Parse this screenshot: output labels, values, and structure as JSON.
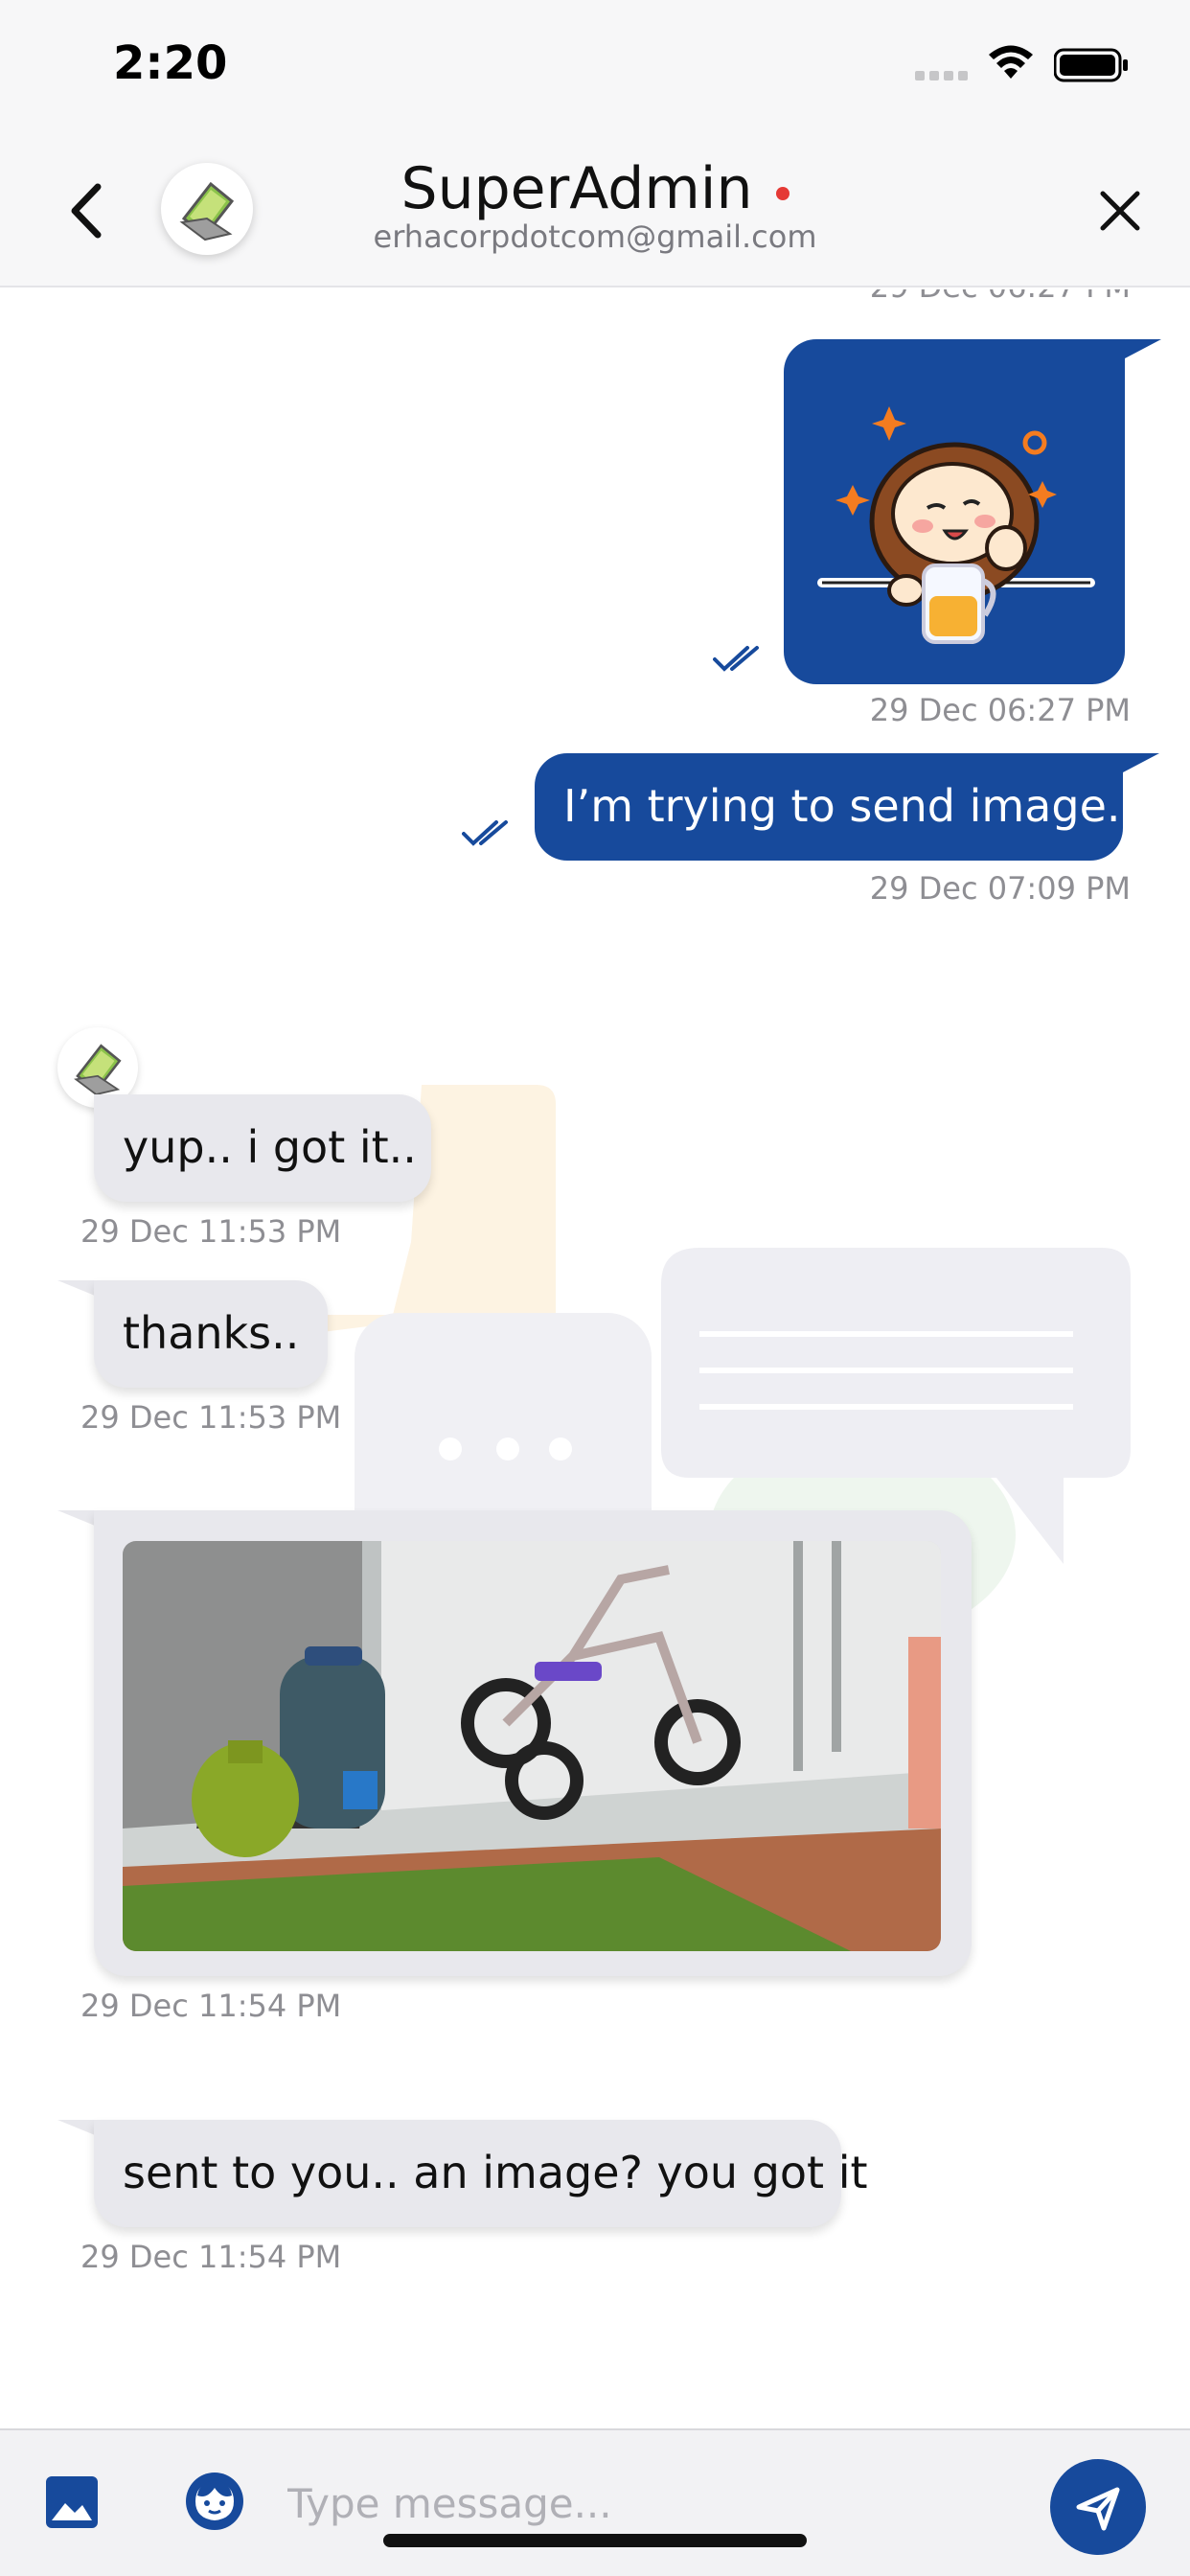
{
  "status_bar": {
    "time": "2:20"
  },
  "header": {
    "contact_name": "SuperAdmin",
    "contact_email": "erhacorpdotcom@gmail.com",
    "online_status_color": "#e53935"
  },
  "messages": [
    {
      "direction": "outgoing",
      "type": "sticker",
      "description_icon": "girl-with-drink-sticker",
      "timestamp": "29 Dec 06:27 PM",
      "read": true
    },
    {
      "direction": "outgoing",
      "type": "text",
      "text": "I’m trying to send image..",
      "timestamp": "29 Dec 07:09 PM",
      "read": true
    },
    {
      "direction": "incoming",
      "type": "text",
      "text": "yup.. i got it..",
      "timestamp": "29 Dec 11:53 PM"
    },
    {
      "direction": "incoming",
      "type": "text",
      "text": "thanks..",
      "timestamp": "29 Dec 11:53 PM"
    },
    {
      "direction": "incoming",
      "type": "image",
      "description_icon": "tricycle-photo",
      "timestamp": "29 Dec 11:54 PM"
    },
    {
      "direction": "incoming",
      "type": "text",
      "text": "sent to you.. an image? you got it",
      "timestamp": "29 Dec 11:54 PM"
    }
  ],
  "partial_top_timestamp": "29 Dec 06:27 PM",
  "composer": {
    "placeholder": "Type message..."
  },
  "colors": {
    "brand_blue": "#174a9c",
    "incoming_bubble": "#e8e8ed"
  }
}
